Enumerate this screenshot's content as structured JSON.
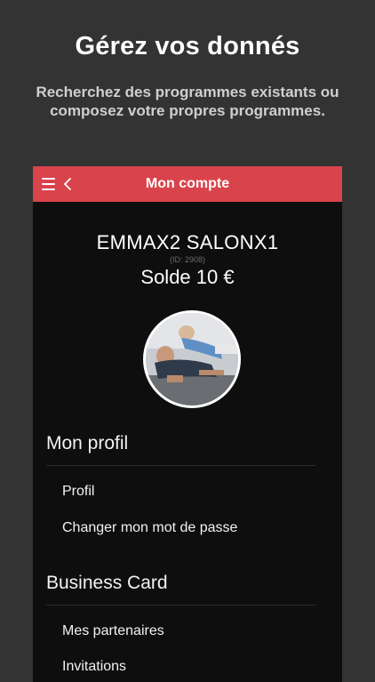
{
  "promo": {
    "headline": "Gérez vos donnés",
    "subtitle": "Recherchez des programmes existants ou composez votre propres programmes."
  },
  "topbar": {
    "title": "Mon compte",
    "color": "#d9434b",
    "left_icons": [
      "menu-icon",
      "chevron-left-icon"
    ]
  },
  "account": {
    "name": "EMMAX2 SALONX1",
    "id_text": "(ID: 2908)",
    "balance": "Solde 10 €"
  },
  "sections": [
    {
      "title": "Mon profil",
      "items": [
        "Profil",
        "Changer mon mot de passe"
      ]
    },
    {
      "title": "Business Card",
      "items": [
        "Mes partenaires",
        "Invitations"
      ]
    }
  ]
}
